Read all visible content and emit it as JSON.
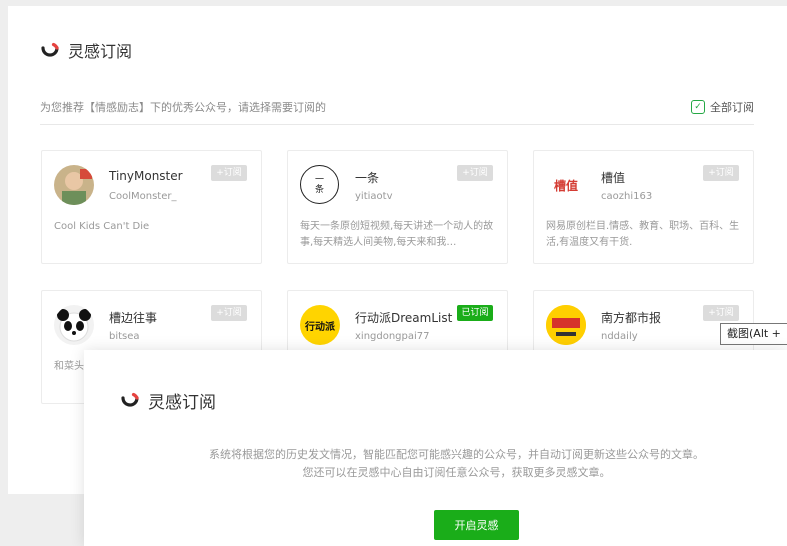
{
  "header": {
    "title": "灵感订阅"
  },
  "recommend": {
    "subtitle": "为您推荐【情感励志】下的优秀公众号，请选择需要订阅的",
    "subscribe_all": "全部订阅"
  },
  "cards": [
    {
      "name": "TinyMonster",
      "handle": "CoolMonster_",
      "button": "+订阅",
      "desc": "Cool Kids Can't Die",
      "avatar_icon": "child-photo-avatar"
    },
    {
      "name": "一条",
      "handle": "yitiaotv",
      "button": "+订阅",
      "desc": "每天一条原创短视频,每天讲述一个动人的故事,每天精选人间美物,每天来和我…",
      "avatar_icon": "yitiao-logo",
      "avatar_text": "一条"
    },
    {
      "name": "槽值",
      "handle": "caozhi163",
      "button": "+订阅",
      "desc": "网易原创栏目.情感、教育、职场、百科、生活,有温度又有干货.",
      "avatar_icon": "caozhi-logo",
      "avatar_text": "槽值"
    },
    {
      "name": "槽边往事",
      "handle": "bitsea",
      "button": "+订阅",
      "desc": "和菜头",
      "avatar_icon": "panda-avatar"
    },
    {
      "name": "行动派DreamList",
      "handle": "xingdongpai77",
      "button": "已订阅",
      "desc": "",
      "avatar_icon": "xingdongpai-logo",
      "avatar_text": "行动派"
    },
    {
      "name": "南方都市报",
      "handle": "nddaily",
      "button": "+订阅",
      "desc": "",
      "avatar_icon": "nanfang-logo"
    }
  ],
  "tooltip": {
    "text": "截图(Alt +"
  },
  "modal": {
    "title": "灵感订阅",
    "line1": "系统将根据您的历史发文情况，智能匹配您可能感兴趣的公众号，并自动订阅更新这些公众号的文章。",
    "line2": "您还可以在灵感中心自由订阅任意公众号，获取更多灵感文章。",
    "button": "开启灵感"
  },
  "colors": {
    "accent": "#1aad19",
    "logo_red": "#e64340",
    "logo_dark": "#222222"
  }
}
